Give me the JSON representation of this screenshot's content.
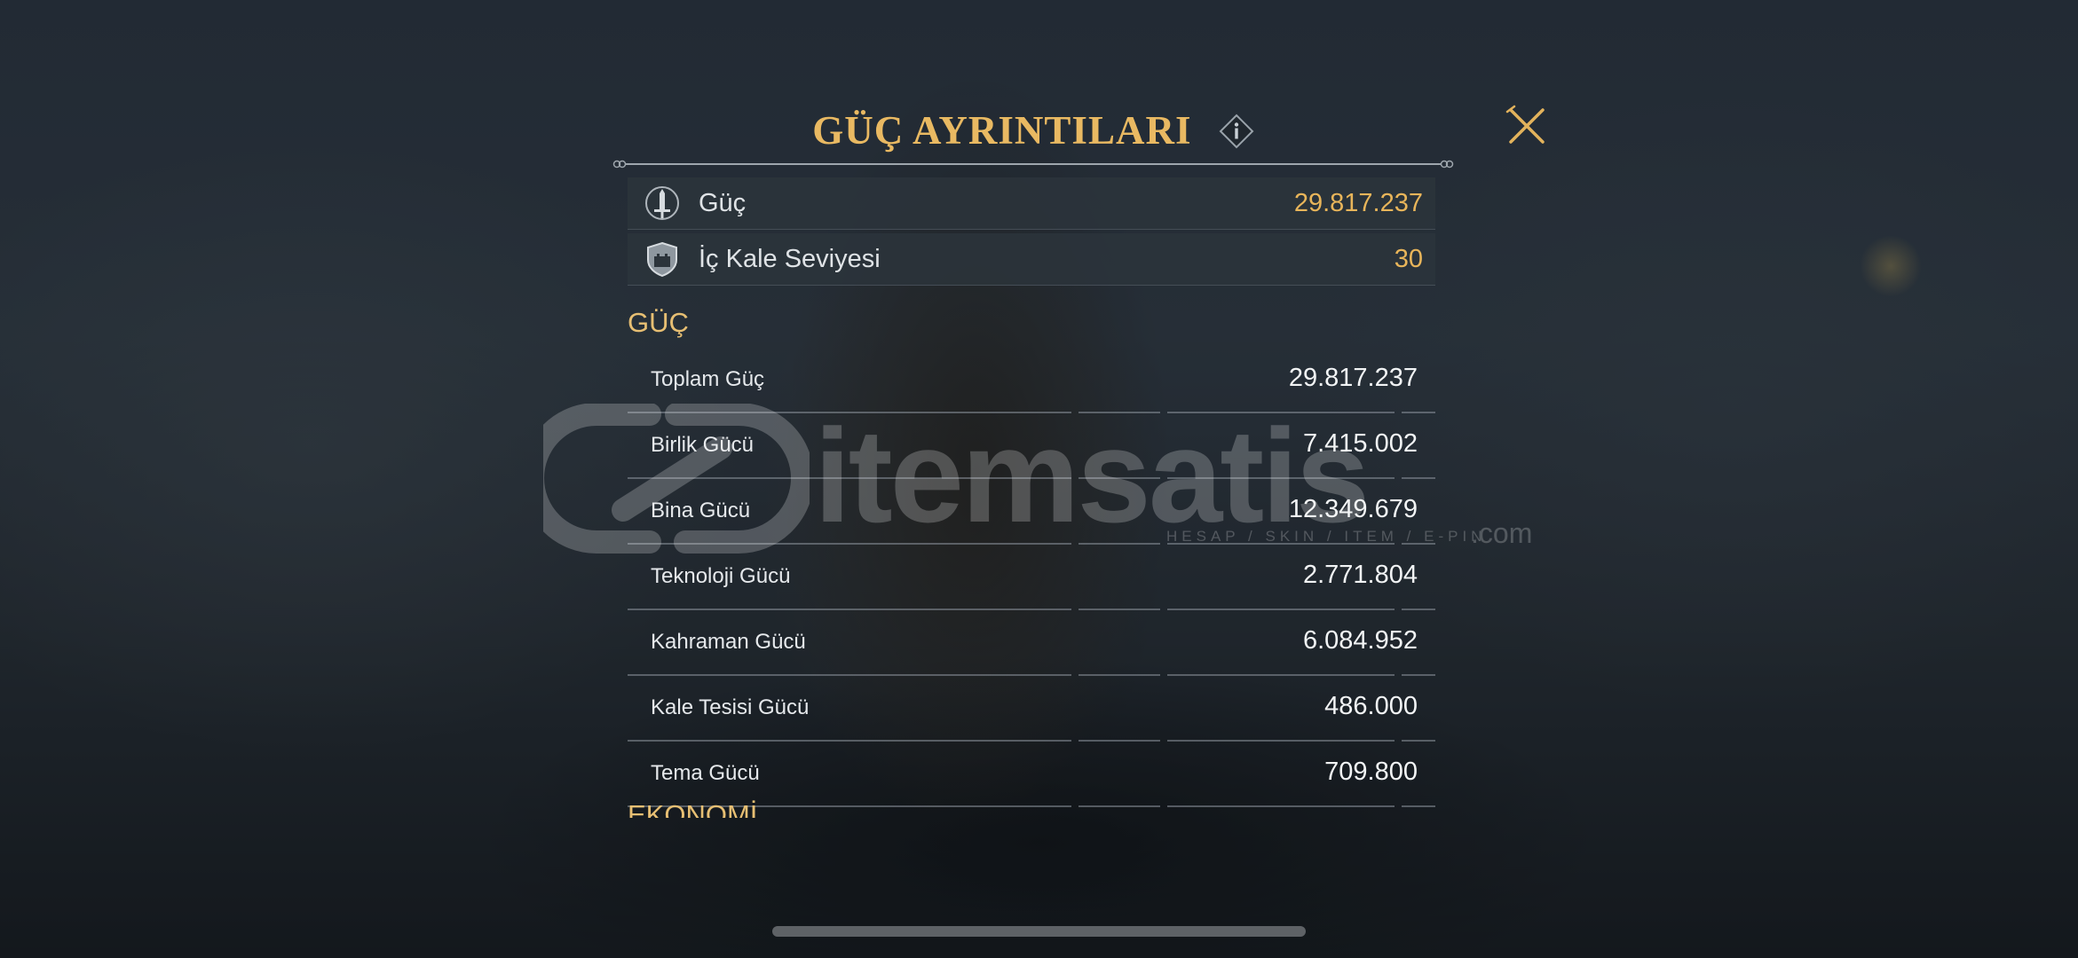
{
  "dialog": {
    "title": "GÜÇ AYRINTILARI",
    "info_icon": "info-icon",
    "close_icon": "close-icon"
  },
  "summary": [
    {
      "icon": "sword-icon",
      "label": "Güç",
      "value": "29.817.237"
    },
    {
      "icon": "castle-shield-icon",
      "label": "İç Kale Seviyesi",
      "value": "30"
    }
  ],
  "sections": [
    {
      "title": "GÜÇ",
      "rows": [
        {
          "label": "Toplam Güç",
          "value": "29.817.237"
        },
        {
          "label": "Birlik Gücü",
          "value": "7.415.002"
        },
        {
          "label": "Bina Gücü",
          "value": "12.349.679"
        },
        {
          "label": "Teknoloji Gücü",
          "value": "2.771.804"
        },
        {
          "label": "Kahraman Gücü",
          "value": "6.084.952"
        },
        {
          "label": "Kale Tesisi Gücü",
          "value": "486.000"
        },
        {
          "label": "Tema Gücü",
          "value": "709.800"
        }
      ]
    },
    {
      "title": "EKONOMİ"
    }
  ],
  "watermark": {
    "brand": "itemsatis",
    "tagline": "HESAP / SKIN / ITEM / E-PIN",
    "suffix": ".com"
  },
  "colors": {
    "accent_gold": "#e9b962",
    "value_gold": "#e8b55a",
    "text_light": "#e6e9ec"
  }
}
